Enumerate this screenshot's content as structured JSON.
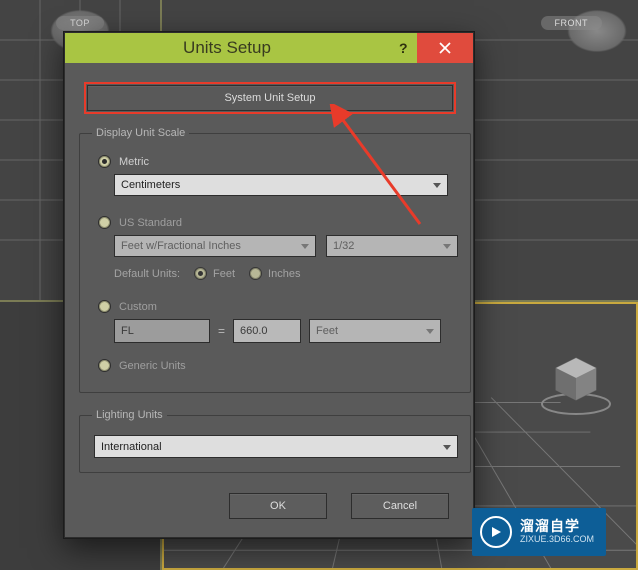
{
  "viewports": {
    "top_label": "TOP",
    "front_label": "FRONT"
  },
  "dialog": {
    "title": "Units Setup",
    "system_unit_button": "System Unit Setup",
    "display_scale_legend": "Display Unit Scale",
    "metric_label": "Metric",
    "metric_value": "Centimeters",
    "us_label": "US Standard",
    "us_type_value": "Feet w/Fractional Inches",
    "us_fraction_value": "1/32",
    "default_units_label": "Default Units:",
    "default_units_feet": "Feet",
    "default_units_inches": "Inches",
    "custom_label": "Custom",
    "custom_abbr": "FL",
    "custom_equals": "=",
    "custom_value": "660.0",
    "custom_unit": "Feet",
    "generic_label": "Generic Units",
    "lighting_legend": "Lighting Units",
    "lighting_value": "International",
    "ok": "OK",
    "cancel": "Cancel"
  },
  "watermark": {
    "brand": "溜溜自学",
    "url": "ZIXUE.3D66.COM"
  }
}
